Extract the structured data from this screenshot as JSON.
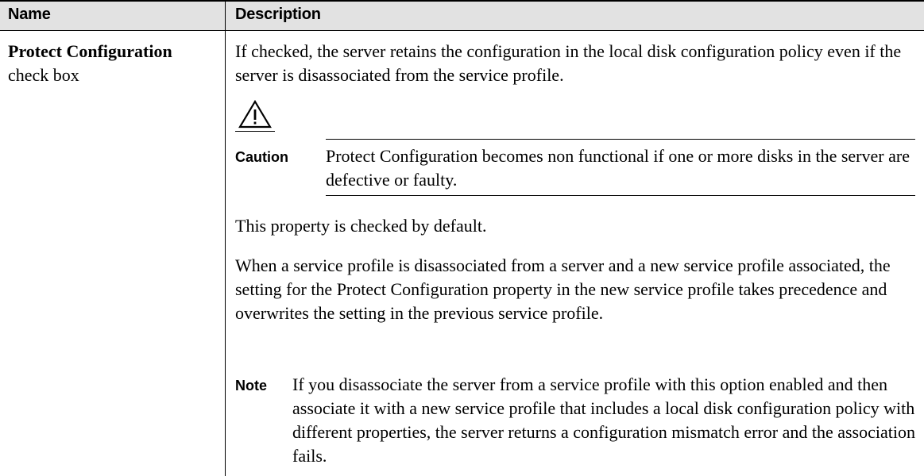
{
  "table": {
    "headers": {
      "name": "Name",
      "description": "Description"
    },
    "row": {
      "name_bold": "Protect Configuration",
      "name_sub": "check box",
      "intro": "If checked, the server retains the configuration in the local disk configuration policy even if the server is disassociated from the service profile.",
      "caution": {
        "label": "Caution",
        "text": "Protect Configuration becomes non functional if one or more disks in the server are defective or faulty.",
        "icon": "warning-triangle-icon"
      },
      "default_text": "This property is checked by default.",
      "precedence_text": "When a service profile is disassociated from a server and a new service profile associated, the setting for the Protect Configuration property in the new service profile takes precedence and overwrites the setting in the previous service profile.",
      "note": {
        "label": "Note",
        "text": "If you disassociate the server from a service profile with this option enabled and then associate it with a new service profile that includes a local disk configuration policy with different properties, the server returns a configuration mismatch error and the association fails."
      }
    }
  }
}
